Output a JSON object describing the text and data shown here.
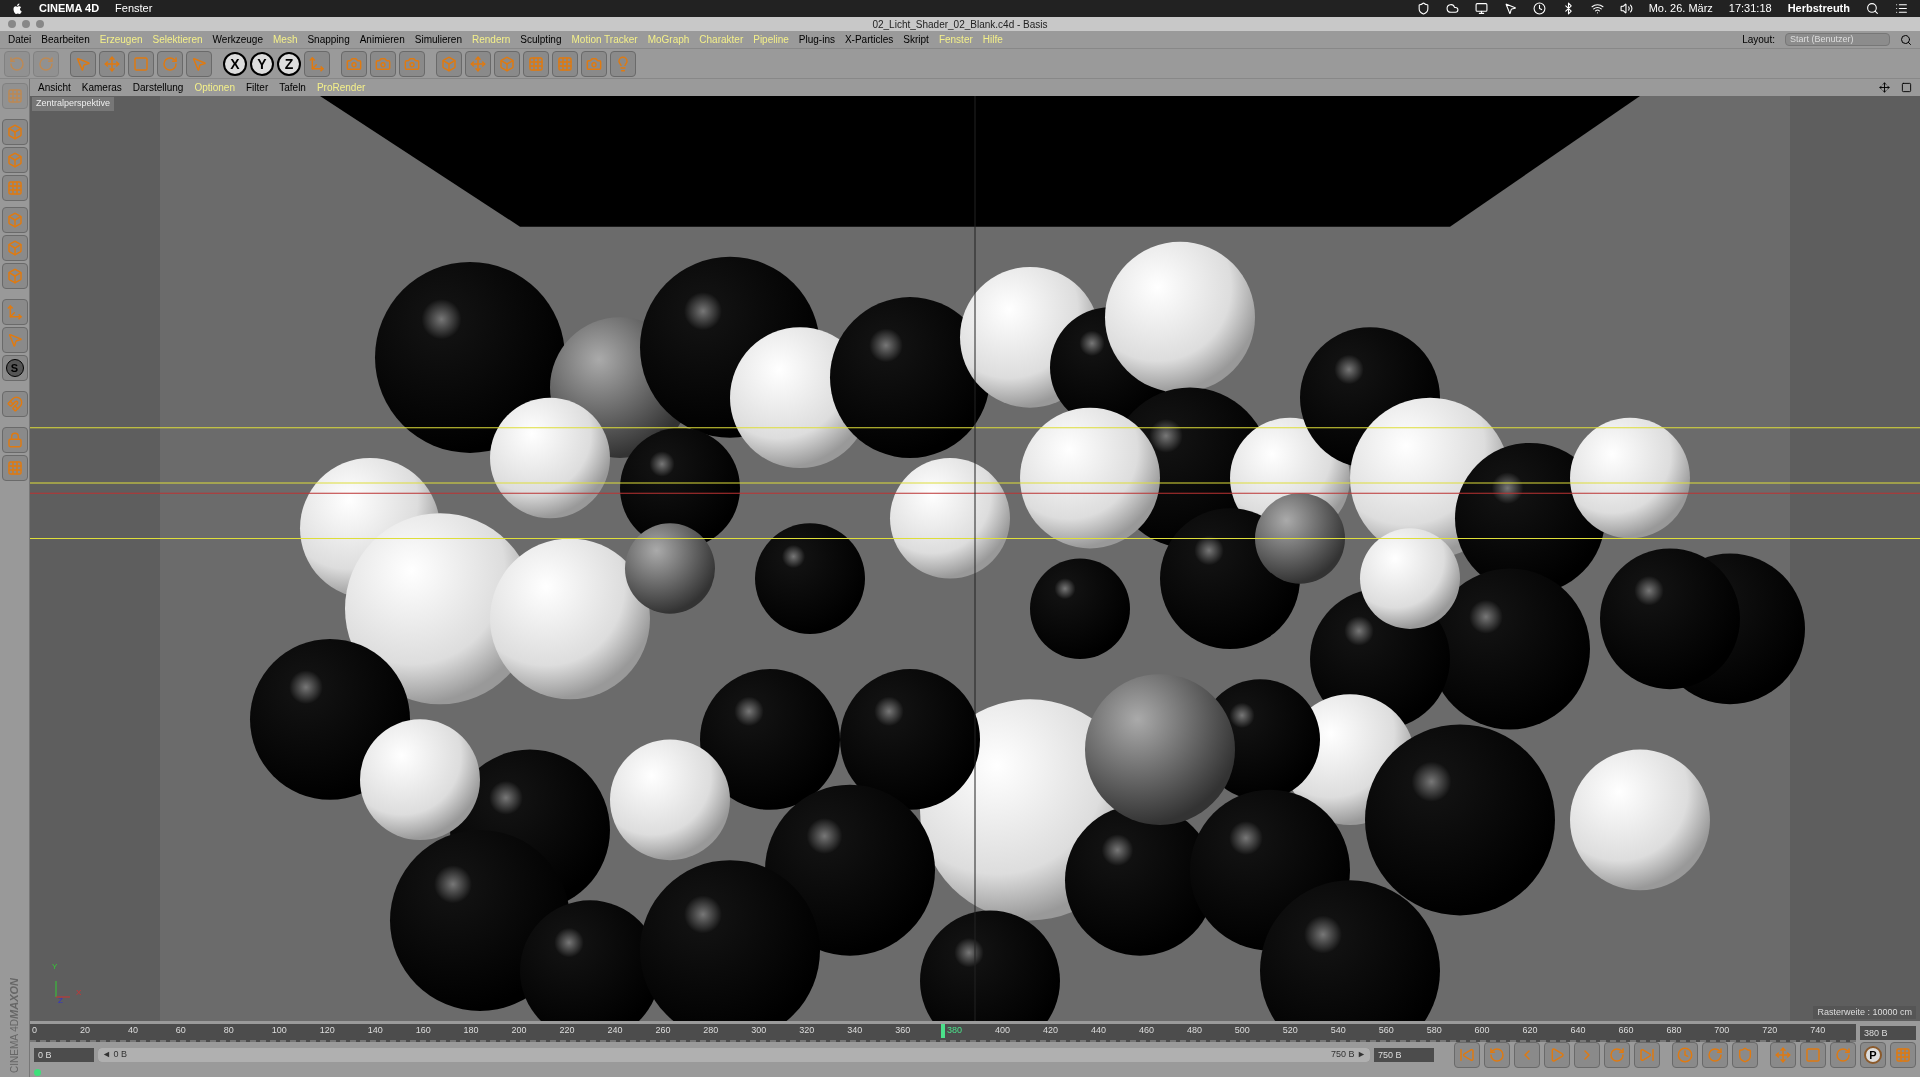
{
  "mac_menubar": {
    "app": "CINEMA 4D",
    "menus": [
      "Fenster"
    ],
    "date": "Mo. 26. März",
    "time": "17:31:18",
    "user": "Herbstreuth"
  },
  "window": {
    "title": "02_Licht_Shader_02_Blank.c4d - Basis"
  },
  "menu": [
    {
      "label": "Datei",
      "highlighted": false
    },
    {
      "label": "Bearbeiten",
      "highlighted": false
    },
    {
      "label": "Erzeugen",
      "highlighted": true
    },
    {
      "label": "Selektieren",
      "highlighted": true
    },
    {
      "label": "Werkzeuge",
      "highlighted": false
    },
    {
      "label": "Mesh",
      "highlighted": true
    },
    {
      "label": "Snapping",
      "highlighted": false
    },
    {
      "label": "Animieren",
      "highlighted": false
    },
    {
      "label": "Simulieren",
      "highlighted": false
    },
    {
      "label": "Rendern",
      "highlighted": true
    },
    {
      "label": "Sculpting",
      "highlighted": false
    },
    {
      "label": "Motion Tracker",
      "highlighted": true
    },
    {
      "label": "MoGraph",
      "highlighted": true
    },
    {
      "label": "Charakter",
      "highlighted": true
    },
    {
      "label": "Pipeline",
      "highlighted": true
    },
    {
      "label": "Plug-ins",
      "highlighted": false
    },
    {
      "label": "X-Particles",
      "highlighted": false
    },
    {
      "label": "Skript",
      "highlighted": false
    },
    {
      "label": "Fenster",
      "highlighted": true
    },
    {
      "label": "Hilfe",
      "highlighted": true
    }
  ],
  "layout": {
    "label": "Layout:",
    "value": "Start (Benutzer)"
  },
  "axis_buttons": [
    "X",
    "Y",
    "Z"
  ],
  "left_toolbar": {
    "snap_label": "S"
  },
  "view_menu": [
    {
      "label": "Ansicht",
      "highlighted": false
    },
    {
      "label": "Kameras",
      "highlighted": false
    },
    {
      "label": "Darstellung",
      "highlighted": false
    },
    {
      "label": "Optionen",
      "highlighted": true
    },
    {
      "label": "Filter",
      "highlighted": false
    },
    {
      "label": "Tafeln",
      "highlighted": false
    },
    {
      "label": "ProRender",
      "highlighted": true
    }
  ],
  "viewport": {
    "camera": "Zentralperspektive",
    "grid": "Rasterweite : 10000 cm",
    "axes": [
      "Y",
      "X",
      "Z"
    ]
  },
  "brand": {
    "maker": "MAXON",
    "product": "CINEMA 4D"
  },
  "timeline": {
    "ticks": [
      {
        "label": "0",
        "selected": false
      },
      {
        "label": "20",
        "selected": false
      },
      {
        "label": "40",
        "selected": false
      },
      {
        "label": "60",
        "selected": false
      },
      {
        "label": "80",
        "selected": false
      },
      {
        "label": "100",
        "selected": false
      },
      {
        "label": "120",
        "selected": false
      },
      {
        "label": "140",
        "selected": false
      },
      {
        "label": "160",
        "selected": false
      },
      {
        "label": "180",
        "selected": false
      },
      {
        "label": "200",
        "selected": false
      },
      {
        "label": "220",
        "selected": false
      },
      {
        "label": "240",
        "selected": false
      },
      {
        "label": "260",
        "selected": false
      },
      {
        "label": "280",
        "selected": false
      },
      {
        "label": "300",
        "selected": false
      },
      {
        "label": "320",
        "selected": false
      },
      {
        "label": "340",
        "selected": false
      },
      {
        "label": "360",
        "selected": false
      },
      {
        "label": "380",
        "selected": true
      },
      {
        "label": "400",
        "selected": false
      },
      {
        "label": "420",
        "selected": false
      },
      {
        "label": "440",
        "selected": false
      },
      {
        "label": "460",
        "selected": false
      },
      {
        "label": "480",
        "selected": false
      },
      {
        "label": "500",
        "selected": false
      },
      {
        "label": "520",
        "selected": false
      },
      {
        "label": "540",
        "selected": false
      },
      {
        "label": "560",
        "selected": false
      },
      {
        "label": "580",
        "selected": false
      },
      {
        "label": "600",
        "selected": false
      },
      {
        "label": "620",
        "selected": false
      },
      {
        "label": "640",
        "selected": false
      },
      {
        "label": "660",
        "selected": false
      },
      {
        "label": "680",
        "selected": false
      },
      {
        "label": "700",
        "selected": false
      },
      {
        "label": "720",
        "selected": false
      },
      {
        "label": "740",
        "selected": false
      }
    ],
    "current_field": "380 B",
    "start_field": "0 B",
    "range": {
      "level": 1,
      "start": "◄ 0 B",
      "end": "750 B ►"
    },
    "end_field": "750 B",
    "key_label": "P"
  }
}
